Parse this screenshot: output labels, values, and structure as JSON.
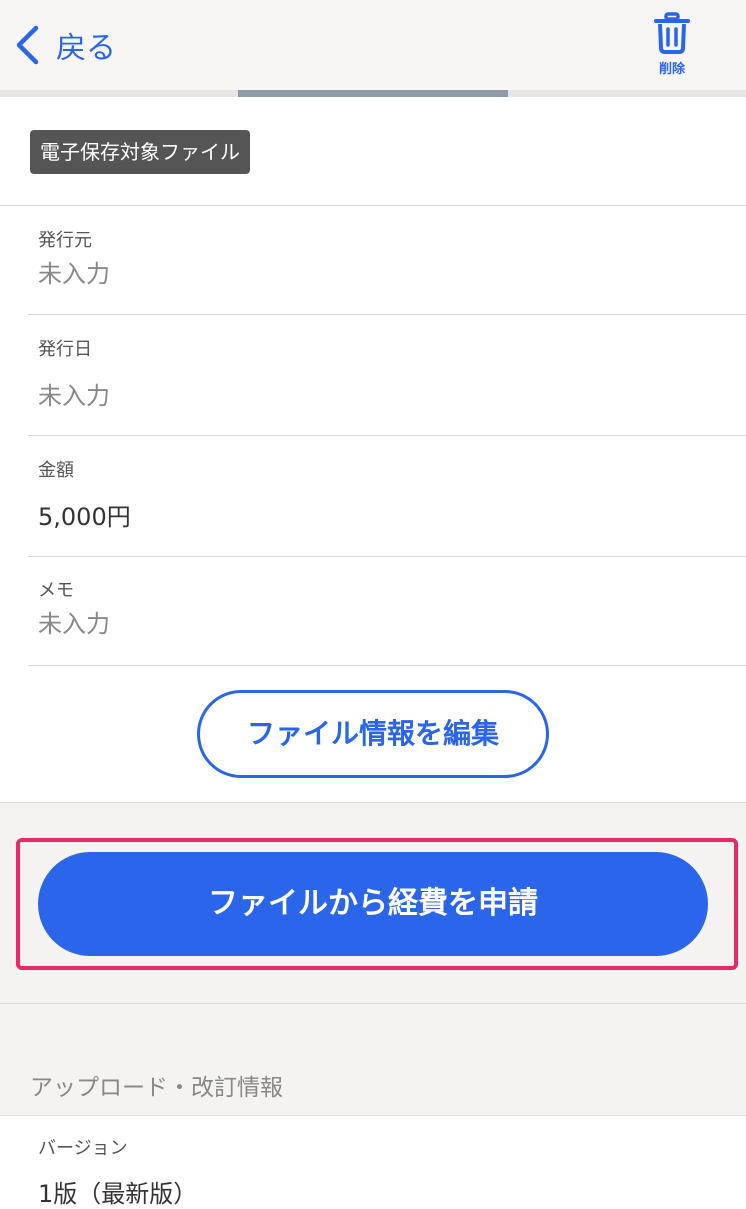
{
  "nav": {
    "back_label": "戻る",
    "delete_label": "削除",
    "icons": {
      "back": "chevron-left-icon",
      "delete": "trash-icon"
    }
  },
  "tag": {
    "label": "電子保存対象ファイル"
  },
  "fields": {
    "issuer": {
      "label": "発行元",
      "value": "未入力"
    },
    "issue_date": {
      "label": "発行日",
      "value": "未入力"
    },
    "amount": {
      "label": "金額",
      "value": "5,000円"
    },
    "memo": {
      "label": "メモ",
      "value": "未入力"
    }
  },
  "buttons": {
    "edit": "ファイル情報を編集",
    "apply": "ファイルから経費を申請"
  },
  "upload_section": {
    "title": "アップロード・改訂情報",
    "version_label": "バージョン",
    "version_value": "1版（最新版）"
  },
  "colors": {
    "accent": "#2b66ea",
    "highlight": "#ea2a68",
    "tag_bg": "#555555"
  }
}
